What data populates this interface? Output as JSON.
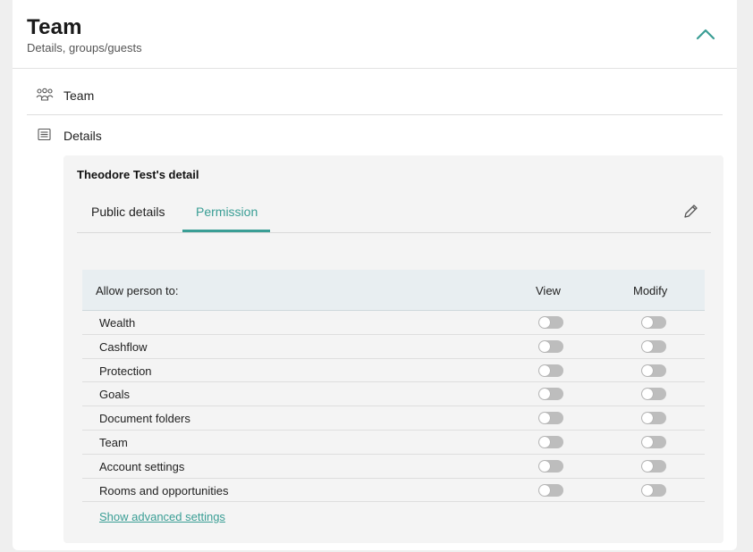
{
  "header": {
    "title": "Team",
    "subtitle": "Details, groups/guests",
    "collapse_icon": "chevron-up-icon",
    "accent_color": "#3a9e95"
  },
  "sections": {
    "team": {
      "label": "Team",
      "icon": "group-icon"
    },
    "details": {
      "label": "Details",
      "icon": "list-icon"
    }
  },
  "detail": {
    "title": "Theodore Test's detail",
    "tabs": [
      {
        "label": "Public details",
        "active": false
      },
      {
        "label": "Permission",
        "active": true
      }
    ],
    "edit_icon": "pencil-icon"
  },
  "permissions": {
    "header": {
      "label": "Allow person to:",
      "view": "View",
      "modify": "Modify"
    },
    "rows": [
      {
        "label": "Wealth",
        "view": false,
        "modify": false
      },
      {
        "label": "Cashflow",
        "view": false,
        "modify": false
      },
      {
        "label": "Protection",
        "view": false,
        "modify": false
      },
      {
        "label": "Goals",
        "view": false,
        "modify": false
      },
      {
        "label": "Document folders",
        "view": false,
        "modify": false
      },
      {
        "label": "Team",
        "view": false,
        "modify": false
      },
      {
        "label": "Account settings",
        "view": false,
        "modify": false
      },
      {
        "label": "Rooms and opportunities",
        "view": false,
        "modify": false
      }
    ],
    "advanced_link": "Show advanced settings"
  }
}
